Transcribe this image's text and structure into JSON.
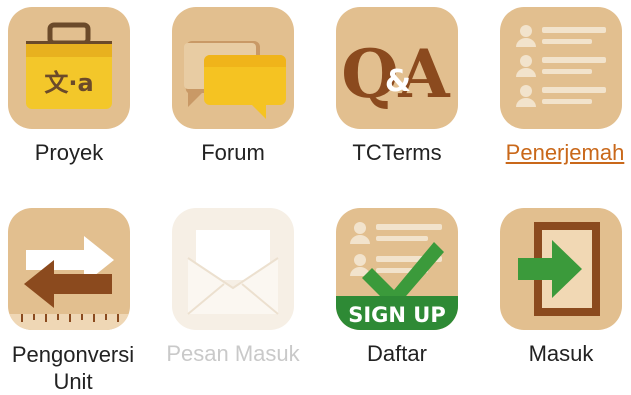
{
  "apps": [
    {
      "label": "Proyek",
      "icon": "translation-suitcase-icon",
      "state": "normal"
    },
    {
      "label": "Forum",
      "icon": "chat-bubbles-icon",
      "state": "normal"
    },
    {
      "label": "TCTerms",
      "icon": "qa-icon",
      "icon_text_q": "Q",
      "icon_text_amp": "&",
      "icon_text_a": "A",
      "state": "normal"
    },
    {
      "label": "Penerjemah",
      "icon": "translator-list-icon",
      "state": "link"
    },
    {
      "label_line1": "Pengonversi",
      "label_line2": "Unit",
      "icon": "unit-converter-icon",
      "state": "normal"
    },
    {
      "label": "Pesan Masuk",
      "icon": "envelope-icon",
      "state": "disabled"
    },
    {
      "label": "Daftar",
      "icon": "sign-up-icon",
      "icon_banner": "SIGN UP",
      "state": "normal"
    },
    {
      "label": "Masuk",
      "icon": "login-door-icon",
      "state": "normal"
    }
  ],
  "colors": {
    "tile_bg": "#e2bf8f",
    "tile_disabled_bg": "#f6efe5",
    "link_orange": "#c9681a",
    "disabled_text": "#c9c9c9",
    "green": "#3b9a3b",
    "brown": "#8b4a1e"
  },
  "icon_glyphs": {
    "translate": "文·a"
  }
}
